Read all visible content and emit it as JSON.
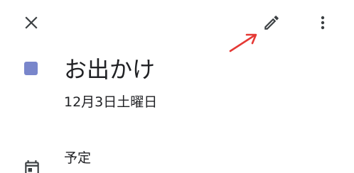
{
  "toolbar": {
    "close_icon": "close-icon",
    "edit_icon": "pencil-icon",
    "more_icon": "more-vert-icon"
  },
  "annotation": {
    "arrow_color": "#e53935"
  },
  "event": {
    "color": "#7986cb",
    "title": "お出かけ",
    "date": "12月3日土曜日"
  },
  "calendar": {
    "icon": "calendar-icon",
    "name": "予定"
  }
}
